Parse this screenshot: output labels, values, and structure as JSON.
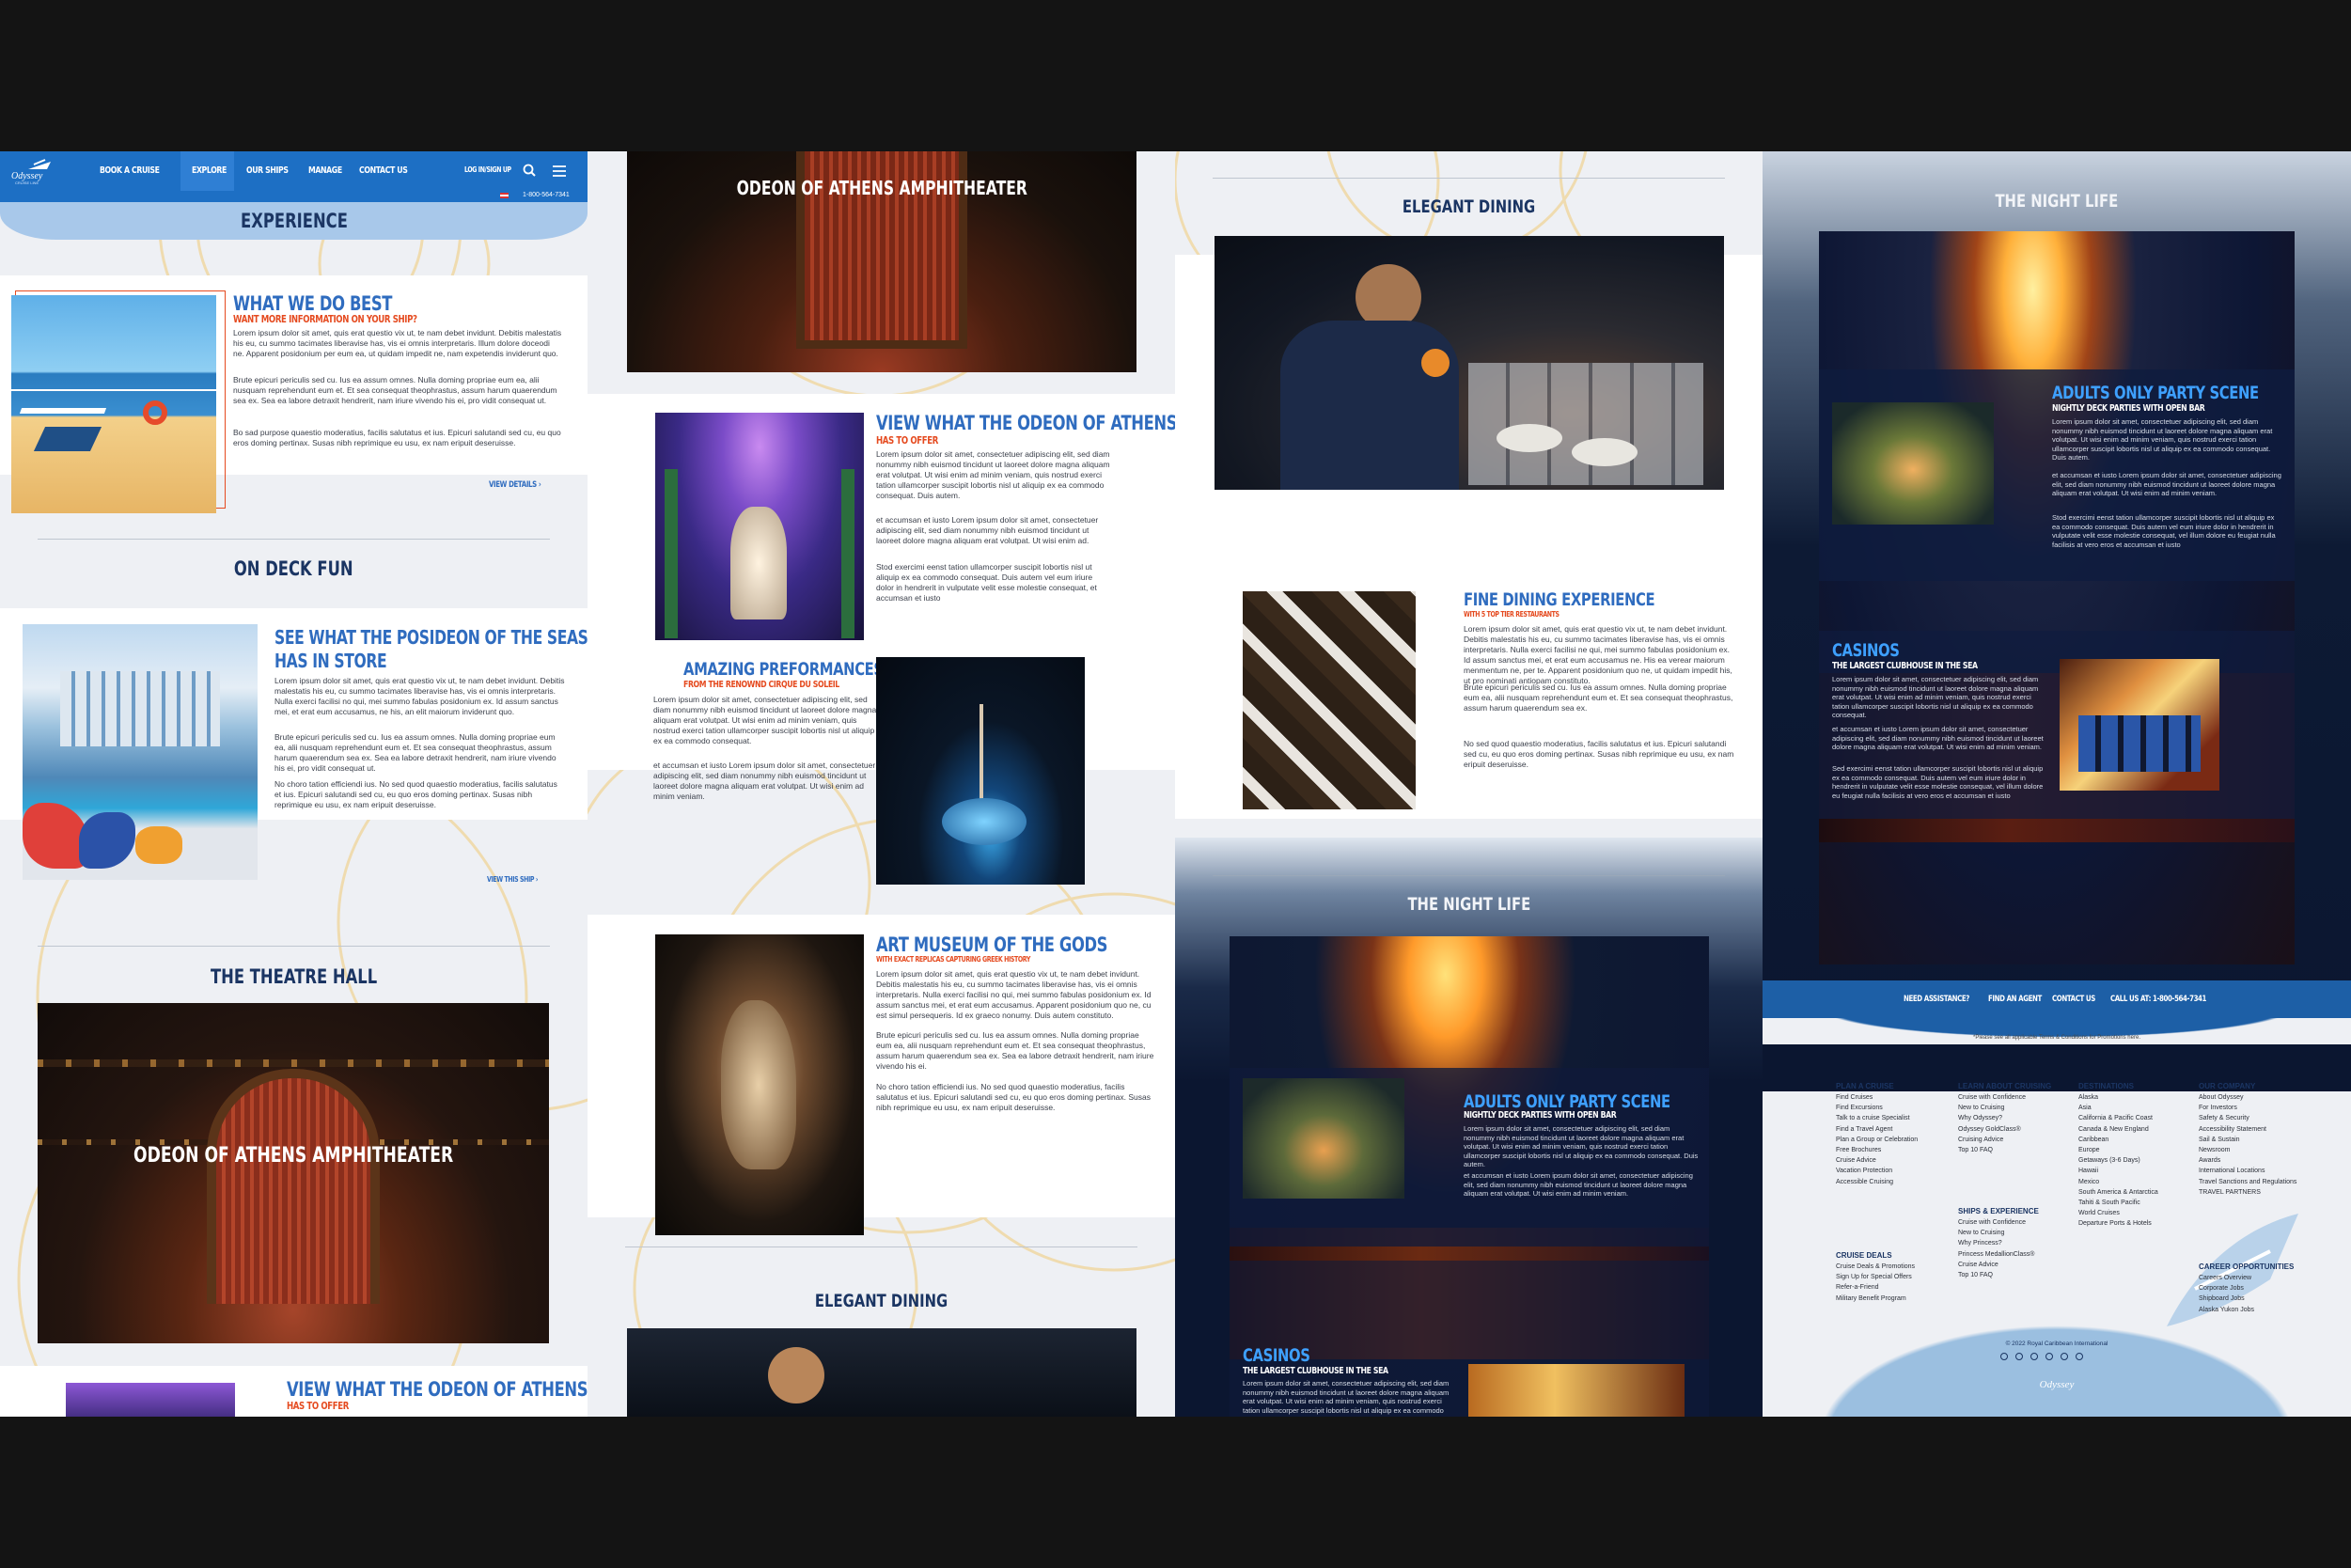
{
  "nav": {
    "logo": "Odyssey",
    "logo_sub": "CRUISE LINE",
    "items": [
      "BOOK A CRUISE",
      "EXPLORE",
      "OUR SHIPS",
      "MANAGE",
      "CONTACT US"
    ],
    "login": "LOG IN/SIGN UP",
    "phone": "1-800-564-7341"
  },
  "sections": {
    "experience": "EXPERIENCE",
    "what_we_do": {
      "title": "WHAT WE DO BEST",
      "sub": "WANT MORE INFORMATION ON YOUR SHIP?",
      "p1": "Lorem ipsum dolor sit amet, quis erat questio vix ut, te nam debet invidunt. Debitis malestatis his eu, cu summo tacimates liberavise has, vis ei omnis interpretaris. Illum dolore doceodi ne. Apparent posidonium per eum ea, ut quidam impedit ne, nam expetendis inviderunt quo.",
      "p2": "Brute epicuri periculis sed cu. Ius ea assum omnes. Nulla doming propriae eum ea, alii nusquam reprehendunt eum et. Et sea consequat theophrastus, assum harum quaerendum sea ex. Sea ea labore detraxit hendrerit, nam iriure vivendo his ei, pro vidit consequat ut.",
      "p3": "Bo sad purpose quaestio moderatius, facilis salutatus et ius. Epicuri salutandi sed cu, eu quo eros doming pertinax. Susas nibh reprimique eu usu, ex nam eripuit deseruisse.",
      "more": "VIEW DETAILS"
    },
    "on_deck": "ON DECK FUN",
    "poseidon": {
      "title1": "SEE WHAT THE POSIDEON OF THE SEAS",
      "title2": "HAS IN STORE",
      "p1": "Lorem ipsum dolor sit amet, quis erat questio vix ut, te nam debet invidunt. Debitis malestatis his eu, cu summo tacimates liberavise has, vis ei omnis interpretaris. Nulla exerci facilisi no qui, mei summo fabulas posidonium ex. Id assum sanctus mei, et erat eum accusamus, ne his, an elit maiorum inviderunt quo.",
      "p2": "Brute epicuri periculis sed cu. Ius ea assum omnes. Nulla doming propriae eum ea, alii nusquam reprehendunt eum et. Et sea consequat theophrastus, assum harum quaerendum sea ex. Sea ea labore detraxit hendrerit, nam iriure vivendo his ei, pro vidit consequat ut.",
      "p3": "No choro tation efficiendi ius. No sed quod quaestio moderatius, facilis salutatus et ius. Epicuri salutandi sed cu, eu quo eros doming pertinax. Susas nibh reprimique eu usu, ex nam eripuit deseruisse.",
      "more": "VIEW THIS SHIP"
    },
    "theatre": "THE THEATRE HALL",
    "odeon": "ODEON OF ATHENS\nAMPHITHEATER",
    "view_odeon": {
      "title": "VIEW WHAT THE ODEON OF ATHENS",
      "sub": "HAS TO OFFER",
      "p1": "Lorem ipsum dolor sit amet, consectetuer adipiscing elit, sed diam nonummy nibh euismod tincidunt ut laoreet dolore magna aliquam erat volutpat. Ut wisi enim ad minim veniam, quis nostrud exerci tation ullamcorper suscipit lobortis nisl ut aliquip ex ea commodo consequat. Duis autem.",
      "p2": "et accumsan et iusto Lorem ipsum dolor sit amet, consectetuer adipiscing elit, sed diam nonummy nibh euismod tincidunt ut laoreet dolore magna aliquam erat volutpat. Ut wisi enim ad.",
      "p3": "Stod exercimi eenst tation ullamcorper suscipit lobortis nisl ut aliquip ex ea commodo consequat. Duis autem vel eum iriure dolor in hendrerit in vulputate velit esse molestie consequat, et accumsan et iusto"
    },
    "performances": {
      "title": "AMAZING PREFORMANCES",
      "sub": "FROM THE RENOWND CIRQUE DU SOLEIL",
      "p1": "Lorem ipsum dolor sit amet, consectetuer adipiscing elit, sed diam nonummy nibh euismod tincidunt ut laoreet dolore magna aliquam erat volutpat. Ut wisi enim ad minim veniam, quis nostrud exerci tation ullamcorper suscipit lobortis nisl ut aliquip ex ea commodo consequat.",
      "p2": "et accumsan et iusto Lorem ipsum dolor sit amet, consectetuer adipiscing elit, sed diam nonummy nibh euismod tincidunt ut laoreet dolore magna aliquam erat volutpat. Ut wisi enim ad minim veniam."
    },
    "museum": {
      "title": "ART MUSEUM OF THE GODS",
      "sub": "WITH EXACT REPLICAS CAPTURING GREEK HISTORY",
      "p1": "Lorem ipsum dolor sit amet, quis erat questio vix ut, te nam debet invidunt. Debitis malestatis his eu, cu summo tacimates liberavise has, vis ei omnis interpretaris. Nulla exerci facilisi no qui, mei summo fabulas posidonium ex. Id assum sanctus mei, et erat eum accusamus. Apparent posidonium quo ne, cu est simul persequeris. Id ex graeco nonumy. Duis autem constituto.",
      "p2": "Brute epicuri periculis sed cu. Ius ea assum omnes. Nulla doming propriae eum ea, alii nusquam reprehendunt eum et. Et sea consequat theophrastus, assum harum quaerendum sea ex. Sea ea labore detraxit hendrerit, nam iriure vivendo his ei.",
      "p3": "No choro tation efficiendi ius. No sed quod quaestio moderatius, facilis salutatus et ius. Epicuri salutandi sed cu, eu quo eros doming pertinax. Susas nibh reprimique eu usu, ex nam eripuit deseruisse."
    },
    "dining": "ELEGANT DINING",
    "fine": {
      "title": "FINE DINING EXPERIENCE",
      "sub": "WITH 5 TOP TIER RESTAURANTS",
      "p1": "Lorem ipsum dolor sit amet, quis erat questio vix ut, te nam debet invidunt. Debitis malestatis his eu, cu summo tacimates liberavise has, vis ei omnis interpretaris. Nulla exerci facilisi ne qui, mei summo fabulas posidonium ex. Id assum sanctus mei, et erat eum accusamus ne. His ea verear maiorum menmentum ne, per te. Apparent posidonium quo ne, ut quidam impedit his, ut pro nominati antiopam constituto.",
      "p2": "Brute epicuri periculis sed cu. Ius ea assum omnes. Nulla doming propriae eum ea, alii nusquam reprehendunt eum et. Et sea consequat theophrastus, assum harum quaerendum sea ex.",
      "p3": "No sed quod quaestio moderatius, facilis salutatus et ius. Epicuri salutandi sed cu, eu quo eros doming pertinax. Susas nibh reprimique eu usu, ex nam eripuit deseruisse."
    },
    "nightlife": "THE NIGHT LIFE",
    "party": {
      "title": "ADULTS ONLY PARTY SCENE",
      "sub": "NIGHTLY DECK PARTIES WITH OPEN BAR",
      "p1": "Lorem ipsum dolor sit amet, consectetuer adipiscing elit, sed diam nonummy nibh euismod tincidunt ut laoreet dolore magna aliquam erat volutpat. Ut wisi enim ad minim veniam, quis nostrud exerci tation ullamcorper suscipit lobortis nisl ut aliquip ex ea commodo consequat. Duis autem.",
      "p2": "et accumsan et iusto Lorem ipsum dolor sit amet, consectetuer adipiscing elit, sed diam nonummy nibh euismod tincidunt ut laoreet dolore magna aliquam erat volutpat. Ut wisi enim ad minim veniam.",
      "p3": "Stod exercimi eenst tation ullamcorper suscipit lobortis nisl ut aliquip ex ea commodo consequat. Duis autem vel eum iriure dolor in hendrerit in vulputate velit esse molestie consequat, vel illum dolore eu feugiat nulla facilisis at vero eros et accumsan et iusto"
    },
    "casinos": {
      "title": "CASINOS",
      "sub": "THE LARGEST CLUBHOUSE IN THE SEA",
      "p1": "Lorem ipsum dolor sit amet, consectetuer adipiscing elit, sed diam nonummy nibh euismod tincidunt ut laoreet dolore magna aliquam erat volutpat. Ut wisi enim ad minim veniam, quis nostrud exerci tation ullamcorper suscipit lobortis nisl ut aliquip ex ea commodo consequat.",
      "p2": "et accumsan et iusto Lorem ipsum dolor sit amet, consectetuer adipiscing elit, sed diam nonummy nibh euismod tincidunt ut laoreet dolore magna aliquam erat volutpat. Ut wisi enim ad minim veniam.",
      "p3": "Sed exercimi eenst tation ullamcorper suscipit lobortis nisl ut aliquip ex ea commodo consequat. Duis autem vel eum iriure dolor in hendrerit in vulputate velit esse molestie consequat, vel illum dolore eu feugiat nulla facilisis at vero eros et accumsan et iusto"
    }
  },
  "footer": {
    "bar": [
      "NEED ASSISTANCE?",
      "FIND AN AGENT",
      "CONTACT US",
      "CALL US AT: 1-800-564-7341"
    ],
    "disclaimer": "*Please see all applicable Terms & Conditions for Promotions here.",
    "cols": [
      {
        "title": "PLAN A CRUISE",
        "links": [
          "Find Cruises",
          "Find Excursions",
          "Talk to a cruise Specialist",
          "Find a Travel Agent",
          "Plan a Group or Celebration",
          "Free Brochures",
          "Cruise Advice",
          "Vacation Protection",
          "Accessible Cruising"
        ]
      },
      {
        "title": "CRUISE DEALS",
        "links": [
          "Cruise Deals & Promotions",
          "Sign Up for Special Offers",
          "Refer-a-Friend",
          "Military Benefit Program"
        ]
      },
      {
        "title": "LEARN ABOUT CRUISING",
        "links": [
          "Cruise with Confidence",
          "New to Cruising",
          "Why Odyssey?",
          "Odyssey GoldClass®",
          "Cruising Advice",
          "Top 10 FAQ"
        ]
      },
      {
        "title": "SHIPS & EXPERIENCE",
        "links": [
          "Cruise with Confidence",
          "New to Cruising",
          "Why Princess?",
          "Princess MedallionClass®",
          "Cruise Advice",
          "Top 10 FAQ"
        ]
      },
      {
        "title": "DESTINATIONS",
        "links": [
          "Alaska",
          "Asia",
          "California & Pacific Coast",
          "Canada & New England",
          "Caribbean",
          "Europe",
          "Getaways (3-6 Days)",
          "Hawaii",
          "Mexico",
          "South America & Antarctica",
          "Tahiti & South Pacific",
          "World Cruises",
          "Departure Ports & Hotels"
        ]
      },
      {
        "title": "OUR COMPANY",
        "links": [
          "About Odyssey",
          "For Investors",
          "Safety & Security",
          "Accessibility Statement",
          "Sail & Sustain",
          "Newsroom",
          "Awards",
          "International Locations",
          "Travel Sanctions and Regulations",
          "TRAVEL PARTNERS"
        ]
      },
      {
        "title": "CAREER OPPORTUNITIES",
        "links": [
          "Careers Overview",
          "Corporate Jobs",
          "Shipboard Jobs",
          "Alaska Yukon Jobs"
        ]
      }
    ],
    "copyright": "© 2022 Royal Caribbean International",
    "logo": "Odyssey"
  },
  "colors": {
    "nav_blue": "#1d6fc4",
    "heading_blue": "#2f6cbf",
    "accent_red": "#e54a1f",
    "navy": "#1b3563"
  }
}
